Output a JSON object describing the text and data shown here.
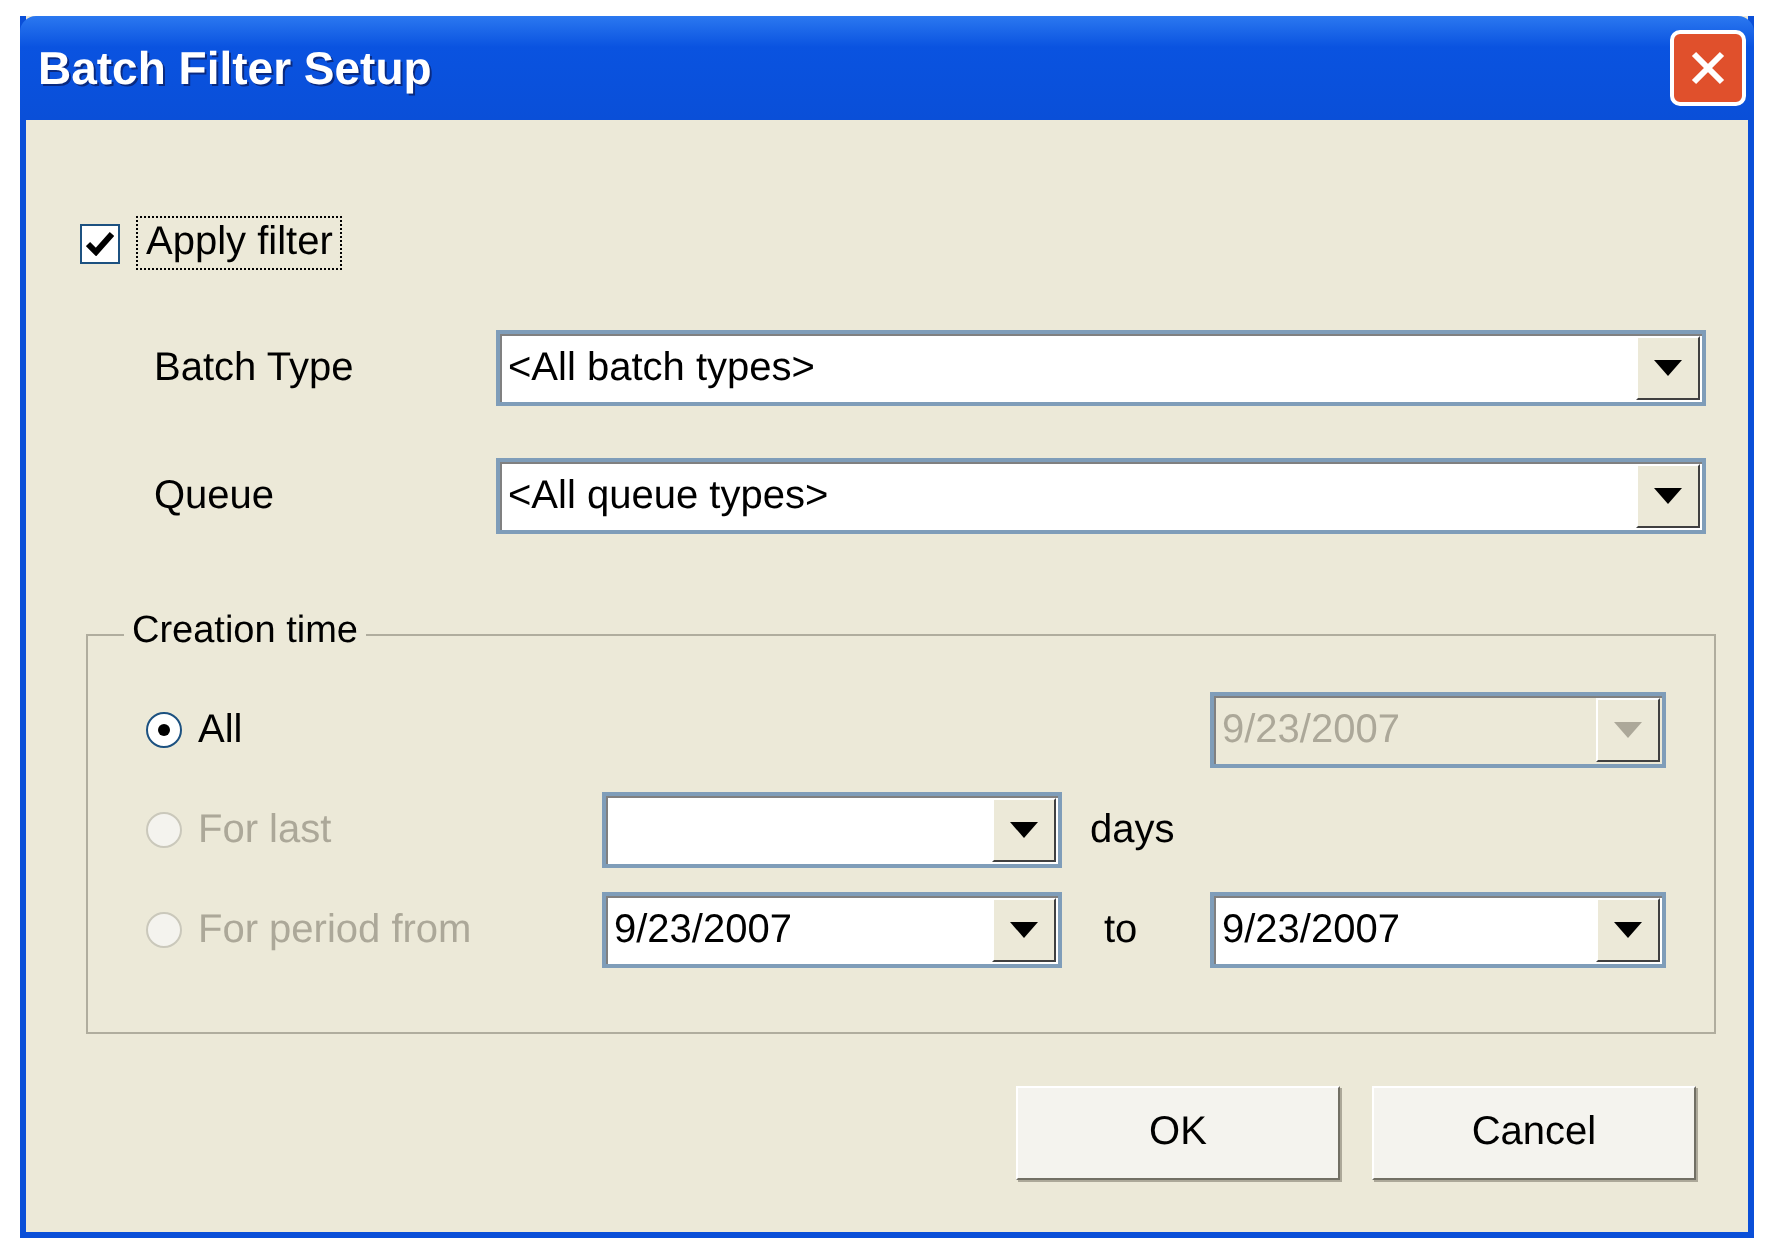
{
  "window": {
    "title": "Batch Filter Setup"
  },
  "apply_filter": {
    "label": "Apply filter",
    "checked": true
  },
  "fields": [
    {
      "label": "Batch Type",
      "value": "<All batch types>"
    },
    {
      "label": "Queue",
      "value": "<All queue types>"
    }
  ],
  "creation_time": {
    "title": "Creation time",
    "options": [
      {
        "label": "All",
        "selected": true,
        "disabled": false
      },
      {
        "label": "For last",
        "selected": false,
        "disabled": true
      },
      {
        "label": "For period from",
        "selected": false,
        "disabled": true
      }
    ],
    "all_date": {
      "value": "9/23/2007",
      "disabled": true
    },
    "days_unit": "days",
    "from_date": {
      "value": "9/23/2007"
    },
    "to_label": "to",
    "to_date": {
      "value": "9/23/2007"
    }
  },
  "buttons": [
    "OK",
    "Cancel"
  ]
}
